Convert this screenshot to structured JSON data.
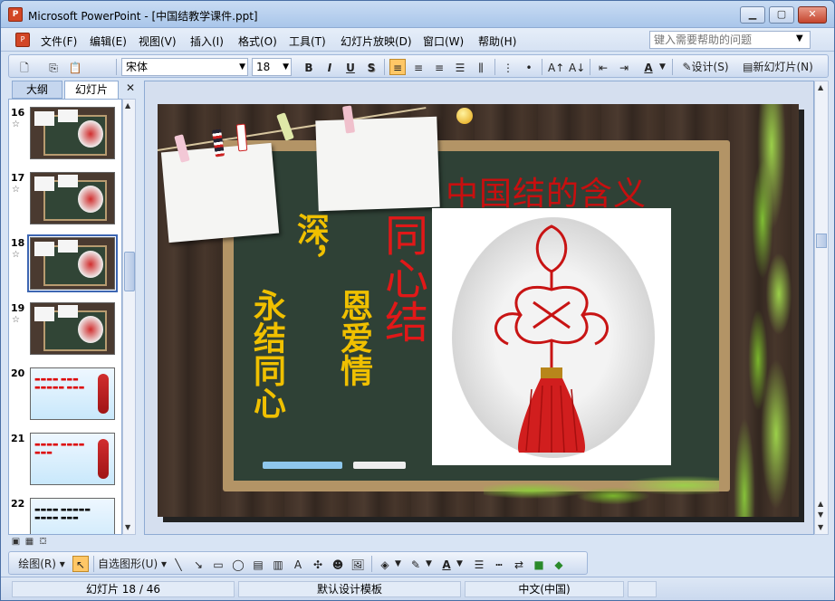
{
  "window": {
    "title": "Microsoft PowerPoint - [中国结教学课件.ppt]"
  },
  "menu": [
    "文件(F)",
    "编辑(E)",
    "视图(V)",
    "插入(I)",
    "格式(O)",
    "工具(T)",
    "幻灯片放映(D)",
    "窗口(W)",
    "帮助(H)"
  ],
  "help": {
    "placeholder": "键入需要帮助的问题"
  },
  "toolbar": {
    "font": "宋体",
    "size": "18",
    "bold": "B",
    "italic": "I",
    "underline": "U",
    "shadow": "S",
    "design": "设计(S)",
    "new_slide": "新幻灯片(N)"
  },
  "pane": {
    "tab_outline": "大纲",
    "tab_slides": "幻灯片",
    "close": "✕"
  },
  "thumbnails": [
    {
      "num": "16",
      "style": "dark"
    },
    {
      "num": "17",
      "style": "dark"
    },
    {
      "num": "18",
      "style": "dark",
      "selected": true
    },
    {
      "num": "19",
      "style": "dark"
    },
    {
      "num": "20",
      "style": "blue"
    },
    {
      "num": "21",
      "style": "blue"
    },
    {
      "num": "22",
      "style": "blue"
    }
  ],
  "slide": {
    "title": "中国结的含义",
    "v_shen": "深，",
    "v_tongxin": "同心结",
    "v_yongjie": "永结同心",
    "v_enai": "恩爱情"
  },
  "drawbar": {
    "draw": "绘图(R)",
    "autoshapes": "自选图形(U)"
  },
  "status": {
    "slide": "幻灯片 18 / 46",
    "template": "默认设计模板",
    "lang": "中文(中国)"
  }
}
